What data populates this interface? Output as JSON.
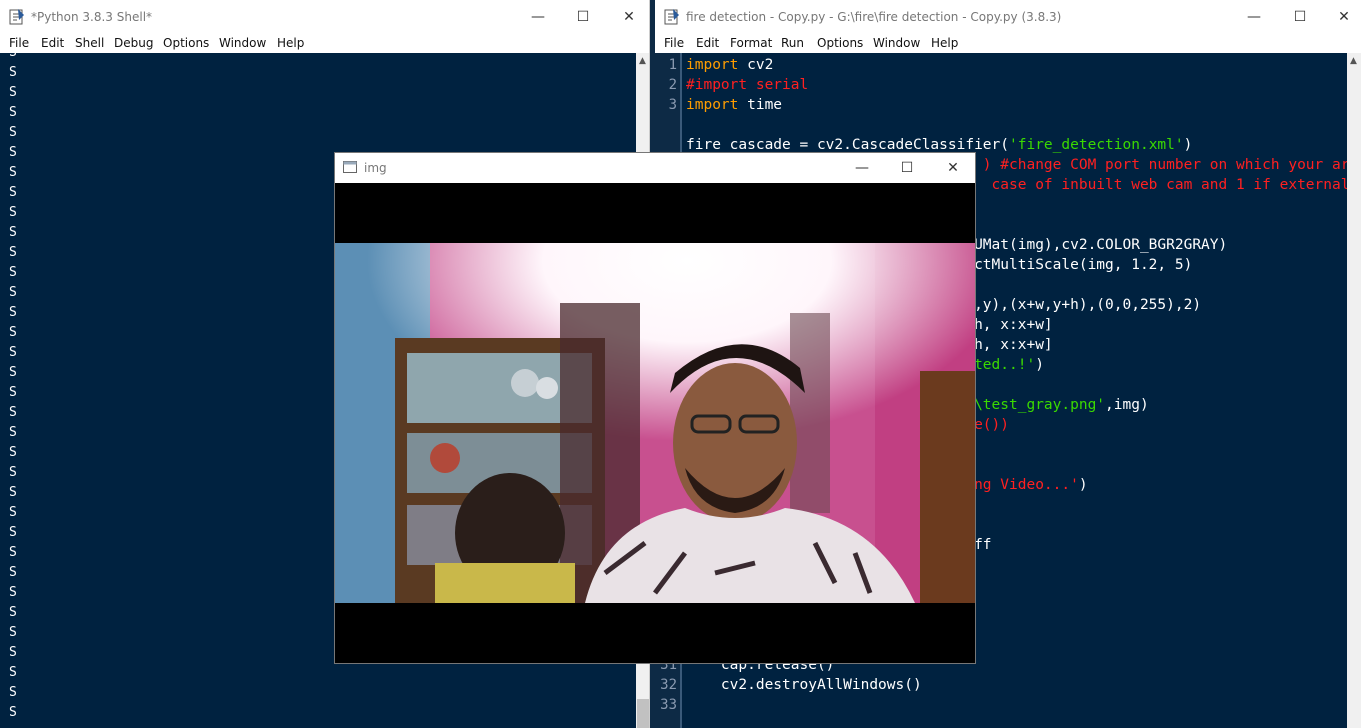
{
  "shell": {
    "title": "*Python 3.8.3 Shell*",
    "menu": [
      "File",
      "Edit",
      "Shell",
      "Debug",
      "Options",
      "Window",
      "Help"
    ],
    "output_char": "S",
    "line_count": 34
  },
  "editor": {
    "title": "fire detection - Copy.py - G:\\fire\\fire detection - Copy.py (3.8.3)",
    "menu": [
      "File",
      "Edit",
      "Format",
      "Run",
      "Options",
      "Window",
      "Help"
    ],
    "code_lines": [
      {
        "n": "1",
        "segs": [
          {
            "c": "kw",
            "t": "import"
          },
          {
            "c": "tx",
            "t": " cv2"
          }
        ]
      },
      {
        "n": "2",
        "segs": [
          {
            "c": "cm",
            "t": "#import serial"
          }
        ]
      },
      {
        "n": "3",
        "segs": [
          {
            "c": "kw",
            "t": "import"
          },
          {
            "c": "tx",
            "t": " time"
          }
        ]
      },
      {
        "n": "",
        "segs": []
      },
      {
        "n": "",
        "segs": [
          {
            "c": "tx",
            "t": "fire_cascade = cv2.CascadeClassifier("
          },
          {
            "c": "st",
            "t": "'fire_detection.xml'"
          },
          {
            "c": "tx",
            "t": ")"
          }
        ]
      },
      {
        "n": "",
        "segs": [
          {
            "c": "cm",
            "t": "                                  ) #change COM port number on which your ar"
          }
        ]
      },
      {
        "n": "",
        "segs": [
          {
            "c": "cm",
            "t": "                                   case of inbuilt web cam and 1 if external"
          }
        ]
      },
      {
        "n": "",
        "segs": []
      },
      {
        "n": "",
        "segs": []
      },
      {
        "n": "",
        "segs": [
          {
            "c": "tx",
            "t": "                                 UMat(img),cv2.COLOR_BGR2GRAY)"
          }
        ]
      },
      {
        "n": "",
        "segs": [
          {
            "c": "tx",
            "t": "                                 ctMultiScale(img, 1.2, 5)"
          }
        ]
      },
      {
        "n": "",
        "segs": []
      },
      {
        "n": "",
        "segs": [
          {
            "c": "tx",
            "t": "                                 ,y),(x+w,y+h),(0,0,255),2)"
          }
        ]
      },
      {
        "n": "",
        "segs": [
          {
            "c": "tx",
            "t": "                                 h, x:x+w]"
          }
        ]
      },
      {
        "n": "",
        "segs": [
          {
            "c": "tx",
            "t": "                                 h, x:x+w]"
          }
        ]
      },
      {
        "n": "",
        "segs": [
          {
            "c": "st",
            "t": "                                 ted..!'"
          },
          {
            "c": "tx",
            "t": ")"
          }
        ]
      },
      {
        "n": "",
        "segs": []
      },
      {
        "n": "",
        "segs": [
          {
            "c": "st",
            "t": "                                 \\test_gray.png'"
          },
          {
            "c": "tx",
            "t": ",img)"
          }
        ]
      },
      {
        "n": "",
        "segs": [
          {
            "c": "cm",
            "t": "                                 e())"
          }
        ]
      },
      {
        "n": "",
        "segs": []
      },
      {
        "n": "",
        "segs": []
      },
      {
        "n": "",
        "segs": [
          {
            "c": "cm",
            "t": "                                 ng Video...'"
          },
          {
            "c": "tx",
            "t": ")"
          }
        ]
      },
      {
        "n": "",
        "segs": []
      },
      {
        "n": "",
        "segs": []
      },
      {
        "n": "",
        "segs": [
          {
            "c": "tx",
            "t": "                                 ff"
          }
        ]
      },
      {
        "n": "",
        "segs": []
      },
      {
        "n": "",
        "segs": []
      },
      {
        "n": "",
        "segs": []
      },
      {
        "n": "",
        "segs": []
      },
      {
        "n": "",
        "segs": []
      },
      {
        "n": "31",
        "segs": [
          {
            "c": "tx",
            "t": "    cap.release()"
          }
        ]
      },
      {
        "n": "32",
        "segs": [
          {
            "c": "tx",
            "t": "    cv2.destroyAllWindows()"
          }
        ]
      },
      {
        "n": "33",
        "segs": []
      }
    ]
  },
  "img_window": {
    "title": "img"
  },
  "controls": {
    "minimize": "—",
    "maximize": "☐",
    "close": "✕"
  }
}
